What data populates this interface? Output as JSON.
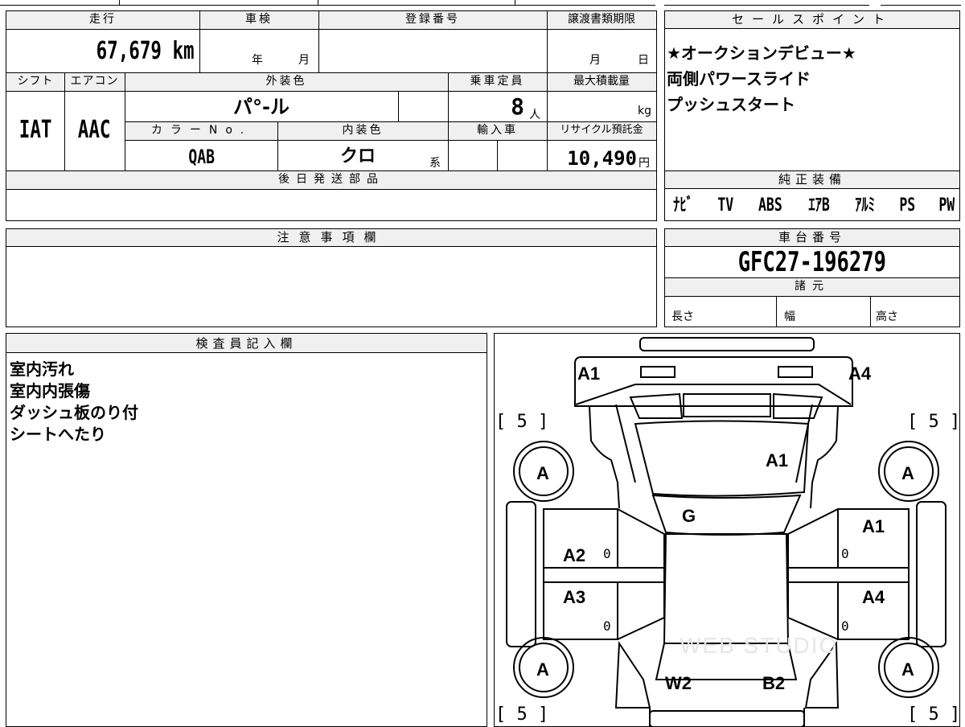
{
  "main": {
    "mileage_label": "走行",
    "mileage_value": "67,679 km",
    "shaken_label": "車検",
    "shaken_year_unit": "年",
    "shaken_month_unit": "月",
    "registration_label": "登録番号",
    "transfer_deadline_label": "譲渡書類期限",
    "transfer_month_unit": "月",
    "transfer_day_unit": "日",
    "shift_label": "シフト",
    "shift_value": "IAT",
    "aircon_label": "エアコン",
    "aircon_value": "AAC",
    "exterior_color_label": "外装色",
    "exterior_color_value": "パ°-ル",
    "capacity_label": "乗車定員",
    "capacity_value": "8",
    "capacity_unit": "人",
    "max_load_label": "最大積載量",
    "max_load_unit": "kg",
    "color_no_label": "カラーNo.",
    "color_no_value": "QAB",
    "interior_color_label": "内装色",
    "interior_color_value": "クロ",
    "interior_color_suffix": "系",
    "import_label": "輸入車",
    "recycle_label": "リサイクル預託金",
    "recycle_value": "10,490",
    "recycle_unit": "円",
    "later_parts_label": "後日発送部品"
  },
  "sales_points": {
    "label": "セールスポイント",
    "lines": [
      "★オークションデビュー★",
      "両側パワースライド",
      "プッシュスタート"
    ]
  },
  "equipment": {
    "label": "純正装備",
    "items": [
      "ﾅﾋﾞ",
      "TV",
      "ABS",
      "ｴｱB",
      "ｱﾙﾐ",
      "PS",
      "PW"
    ]
  },
  "notes": {
    "label": "注意事項欄"
  },
  "chassis": {
    "label": "車台番号",
    "value": "GFC27-196279",
    "specs_label": "諸元",
    "length_label": "長さ",
    "width_label": "幅",
    "height_label": "高さ"
  },
  "inspector": {
    "label": "検査員記入欄",
    "lines": [
      "室内汚れ",
      "室内内張傷",
      "ダッシュ板のり付",
      "シートへたり"
    ]
  },
  "diagram": {
    "labels": {
      "front_left": "A1",
      "front_right": "A4",
      "hood": "A1",
      "windshield": "G",
      "right_front_door": "A1",
      "left_front_door": "A2",
      "left_rear_door": "A3",
      "right_rear_door": "A4",
      "rear_left": "W2",
      "rear_right": "B2",
      "tire_fl": "A",
      "tire_fr": "A",
      "tire_rl": "A",
      "tire_rr": "A",
      "tread_fl": "[ 5 ]",
      "tread_fr": "[ 5 ]",
      "tread_rl": "[ 5 ]",
      "tread_rr": "[ 5 ]",
      "zero": "0"
    },
    "watermark": "WEB STUDIO"
  }
}
